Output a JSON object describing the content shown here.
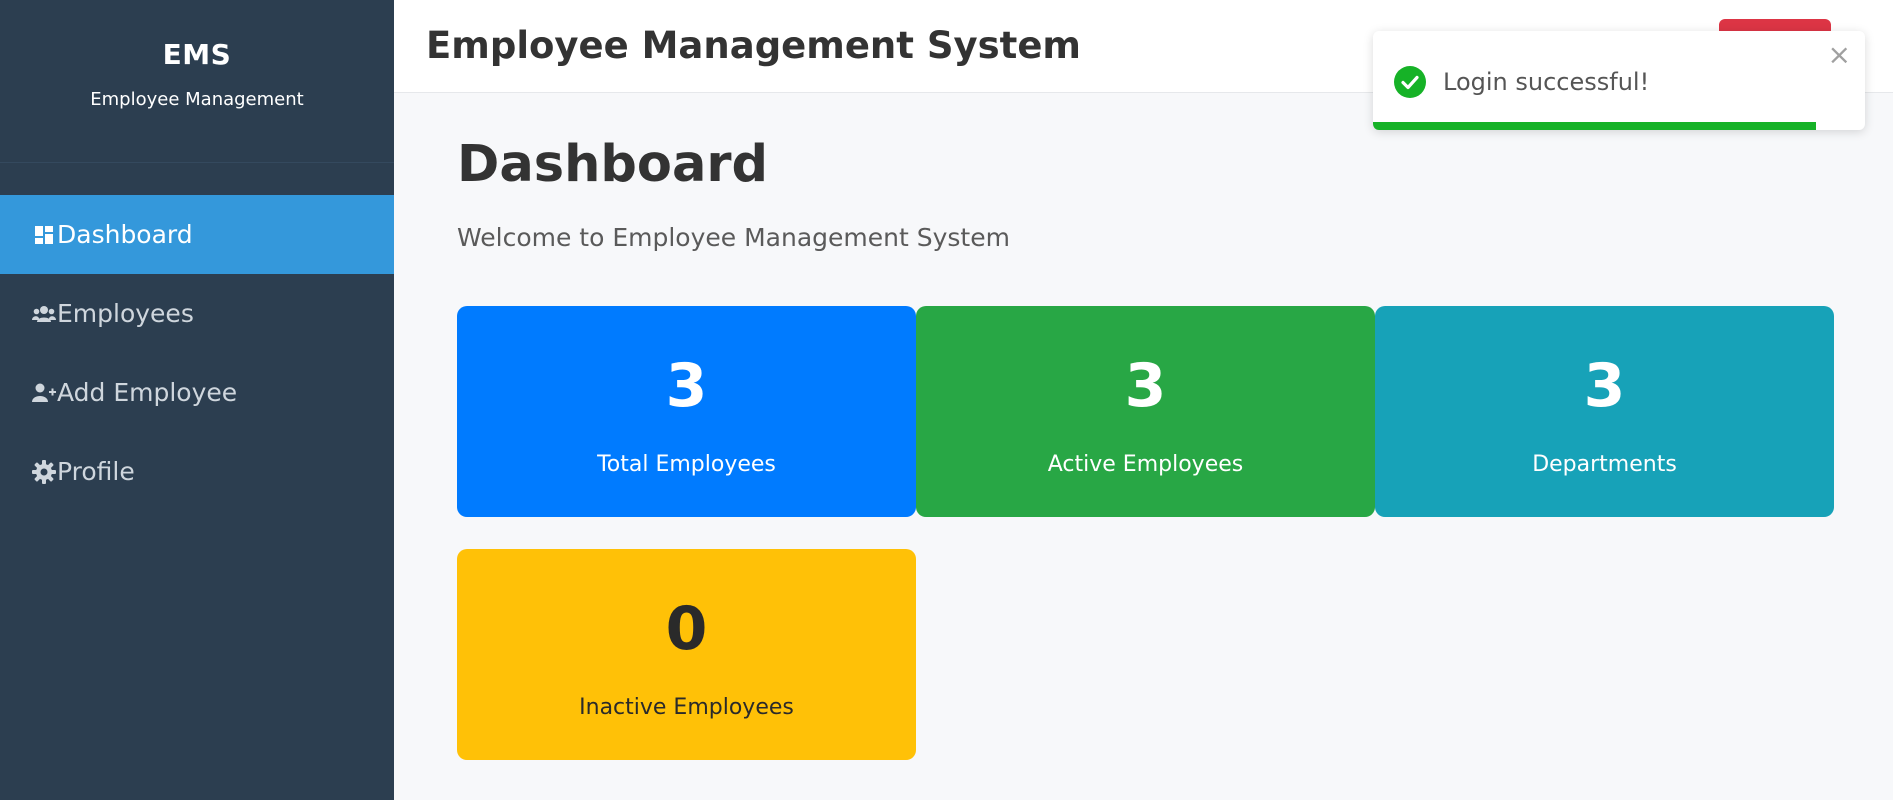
{
  "sidebar": {
    "brand_title": "EMS",
    "brand_subtitle": "Employee Management",
    "items": [
      {
        "label": "Dashboard",
        "icon": "dashboard-icon",
        "active": true
      },
      {
        "label": "Employees",
        "icon": "users-icon",
        "active": false
      },
      {
        "label": "Add Employee",
        "icon": "user-plus-icon",
        "active": false
      },
      {
        "label": "Profile",
        "icon": "gear-icon",
        "active": false
      }
    ]
  },
  "header": {
    "title": "Employee Management System"
  },
  "main": {
    "page_title": "Dashboard",
    "welcome": "Welcome to Employee Management System",
    "cards": [
      {
        "value": "3",
        "label": "Total Employees",
        "color": "#007bff"
      },
      {
        "value": "3",
        "label": "Active Employees",
        "color": "#28a745"
      },
      {
        "value": "3",
        "label": "Departments",
        "color": "#17a2b8"
      },
      {
        "value": "0",
        "label": "Inactive Employees",
        "color": "#ffc107"
      }
    ]
  },
  "toast": {
    "message": "Login successful!",
    "close_symbol": "×",
    "icon": "check-circle-icon",
    "progress": 0.9,
    "accent_color": "#16b227"
  },
  "colors": {
    "sidebar_bg": "#2c3e50",
    "active_item": "#3498db",
    "logout_button": "#dc3545"
  }
}
